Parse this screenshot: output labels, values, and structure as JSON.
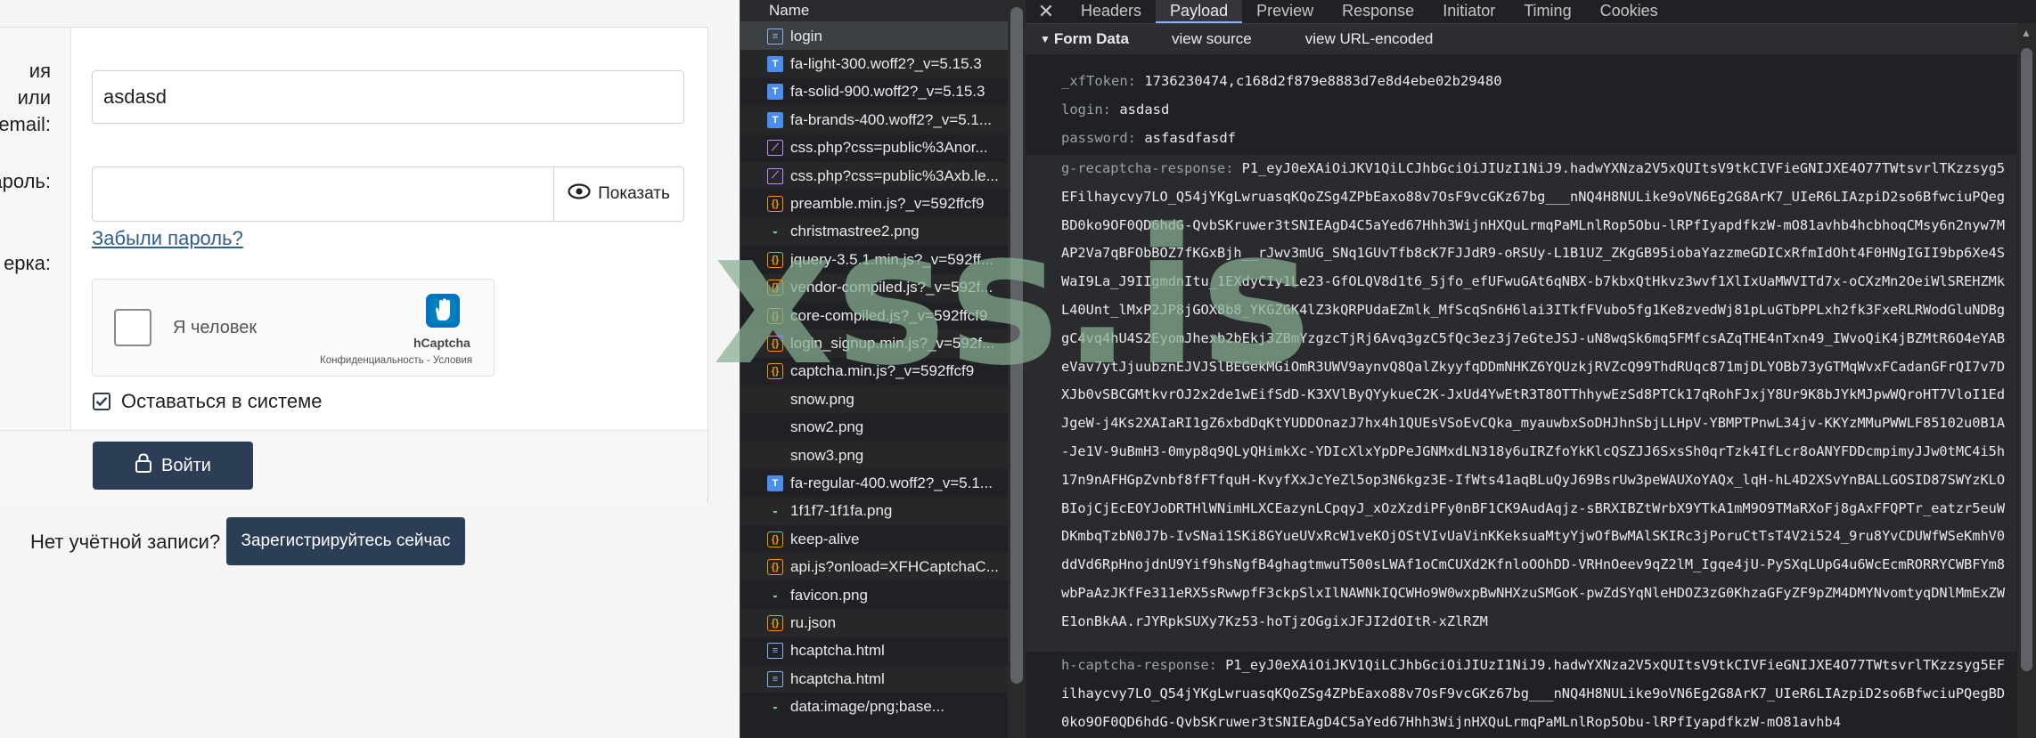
{
  "login": {
    "username_label": "ия или\nemail:",
    "username_value": "asdasd",
    "password_label": "ароль:",
    "show_label": "Показать",
    "forgot_link": "Забыли пароль?",
    "captcha_label": "ерка:",
    "captcha_checkbox_text": "Я человек",
    "captcha_brand": "hCaptcha",
    "captcha_terms": "Конфиденциальность - Условия",
    "remember_label": "Оставаться в системе",
    "login_button": "Войти",
    "no_account_text": "Нет учётной записи?",
    "register_button": "Зарегистрируйтесь сейчас"
  },
  "network": {
    "column_name": "Name",
    "rows": [
      {
        "name": "login",
        "type": "doc"
      },
      {
        "name": "fa-light-300.woff2?_v=5.15.3",
        "type": "font"
      },
      {
        "name": "fa-solid-900.woff2?_v=5.15.3",
        "type": "font"
      },
      {
        "name": "fa-brands-400.woff2?_v=5.1...",
        "type": "font"
      },
      {
        "name": "css.php?css=public%3Anor...",
        "type": "css"
      },
      {
        "name": "css.php?css=public%3Axb.le...",
        "type": "css"
      },
      {
        "name": "preamble.min.js?_v=592ffcf9",
        "type": "js"
      },
      {
        "name": "christmastree2.png",
        "type": "img"
      },
      {
        "name": "jquery-3.5.1.min.js?_v=592ff...",
        "type": "js"
      },
      {
        "name": "vendor-compiled.js?_v=592f...",
        "type": "js"
      },
      {
        "name": "core-compiled.js?_v=592ffcf9",
        "type": "js"
      },
      {
        "name": "login_signup.min.js?_v=592f...",
        "type": "js"
      },
      {
        "name": "captcha.min.js?_v=592ffcf9",
        "type": "js"
      },
      {
        "name": "snow.png",
        "type": "blank"
      },
      {
        "name": "snow2.png",
        "type": "blank"
      },
      {
        "name": "snow3.png",
        "type": "blank"
      },
      {
        "name": "fa-regular-400.woff2?_v=5.1...",
        "type": "font"
      },
      {
        "name": "1f1f7-1f1fa.png",
        "type": "img"
      },
      {
        "name": "keep-alive",
        "type": "js"
      },
      {
        "name": "api.js?onload=XFHCaptchaC...",
        "type": "js"
      },
      {
        "name": "favicon.png",
        "type": "img"
      },
      {
        "name": "ru.json",
        "type": "js"
      },
      {
        "name": "hcaptcha.html",
        "type": "doc"
      },
      {
        "name": "hcaptcha.html",
        "type": "doc"
      },
      {
        "name": "data:image/png;base...",
        "type": "img"
      }
    ]
  },
  "panel": {
    "tabs": [
      "Headers",
      "Payload",
      "Preview",
      "Response",
      "Initiator",
      "Timing",
      "Cookies"
    ],
    "active_tab": "Payload",
    "form_data_title": "Form Data",
    "view_source": "view source",
    "view_url_encoded": "view URL-encoded",
    "fields": {
      "xftoken_key": "_xfToken:",
      "xftoken_value": "1736230474,c168d2f879e8883d7e8d4ebe02b29480",
      "login_key": "login:",
      "login_value": "asdasd",
      "password_key": "password:",
      "password_value": "asfasdfasdf",
      "grecaptcha_key": "g-recaptcha-response:",
      "grecaptcha_value": "P1_eyJ0eXAiOiJKV1QiLCJhbGciOiJIUzI1NiJ9.hadwYXNza2V5xQUItsV9tkCIVFieGNIJXE4O77TWtsvrlTKzzsyg5EFilhaycvy7LO_Q54jYKgLwruasqKQoZSg4ZPbEaxo88v7OsF9vcGKz67bg___nNQ4H8NULike9oVN6Eg2G8ArK7_UIeR6LIAzpiD2so6BfwciuPQegBD0ko9OF0QD6hdG-QvbSKruwer3tSNIEAgD4C5aYed67Hhh3WijnHXQuLrmqPaMLnlRop5Obu-lRPfIyapdfkzW-mO81avhb4hcbhoqCMsy6n2nyw7MAP2Va7qBFObBOZ7fKGxBjh__rJwv3mUG_SNq1GUvTfb8cK7FJJdR9-oRSUy-L1B1UZ_ZKgGB95iobaYazzmeGDICxRfmIdOht4F0HNgIGII9bp6Xe4SWaI9La_J9IIgmdnItu_1EXdyCIy1Le23-GfOLQV8d1t6_5jfo_efUFwuGAt6qNBX-b7kbxQtHkvz3wvf1XlIxUaMWVITd7x-oCXzMn2OeiWlSREHZMkL40Unt_lMxP2JP8jGOX8b8_YKGZGK4lZ3kQRPUdaEZmlk_MfScqSn6H6lai3ITkfFVubo5fg1Ke8zvedWj81pLuGTbPPLxh2fk3FxeRLRWodGluNDBggC4vq4hU4S2EyomJhexb2bEkj3ZBmYzgzcTjRj6Avq3gzC5fQc3ez3j7eGteJSJ-uN8wqSk6mq5FMfcsAZqTHE4nTxn49_IWvoQiK4jBZMtR6O4eYABeVav7ytJjuubznEJVJSlBEGekMGiOmR3UWV9aynvQ8QalZkyyfqDDmNHKZ6YQUzkjRVZcQ99ThdRUqc871mjDLYOBb73yGTMqWvxFCadanGFrQI7v7DXJb0vSBCGMtkvrOJ2x2de1wEifSdD-K3XVlByQYykueC2K-JxUd4YwEtR3T8OTThhywEzSd8PTCk17qRohFJxjY8Ur9K8bJYkMJpwWQroHT7VloI1EdJgeW-j4Ks2XAIaRI1gZ6xbdDqKtYUDDOnazJ7hx4h1QUEsVSoEvCQka_myauwbxSoDHJhnSbjLLHpV-YBMPTPnwL34jv-KKYzMMuPWWLF85102u0B1A-Je1V-9uBmH3-0myp8q9QLyQHimkXc-YDIcXlxYpDPeJGNMxdLN318y6uIRZfoYkKlcQSZJJ6SxsSh0qrTzk4IfLcr8oANYFDDcmpimyJJw0tMC4i5h17n9nAFHGpZvnbf8fFTfquH-KvyfXxJcYeZl5op3N6kgz3E-IfWts41aqBLuQyJ69BsrUw3peWAUXoYAQx_lqH-hL4D2XSvYnBALLGOSID87SWYzKLOBIojCjEcEOYJoDRTHlWNimHLXCEazynLCpqyJ_xOzXzdiPFy0nBF1CK9AudAqjz-sBRXIBZtWrbX9YTkA1mM9O9TMaRXoFj8gAxFFQPTr_eatzr5euWDKmbqTzbN0J7b-IvSNai1SKi8GYueUVxRcW1veKOjOStVIvUaVinKKeksuaMtyYjwOfBwMAlSKIRc3jPoruCtTsT4V2i524_9ru8YvCDUWfWSeKmhV0ddVd6RpHnojdnU9Yif9hsNgfB4ghagtmwuT500sLWAf1oCmCUXd2KfnloOOhDD-VRHnOeev9qZ2lM_Igqe4jU-PySXqLUpG4u6WcEcmRORRYCWBFYm8wbPaAzJKfFe311eRX5sRwwpfF3ckpSlxIlNAWNkIQCWHo9W0wxpBwNHXzuSMGoK-pwZdSYqNleHDOZ3zG0KhzaGFyZF9pZM4DMYNvomtyqDNlMmExZWE1onBkAA.rJYRpkSUXy7Kz53-hoTjzOGgixJFJI2dOItR-xZlRZM",
      "hcaptcha_key": "h-captcha-response:",
      "hcaptcha_value": "P1_eyJ0eXAiOiJKV1QiLCJhbGciOiJIUzI1NiJ9.hadwYXNza2V5xQUItsV9tkCIVFieGNIJXE4O77TWtsvrlTKzzsyg5EFilhaycvy7LO_Q54jYKgLwruasqKQoZSg4ZPbEaxo88v7OsF9vcGKz67bg___nNQ4H8NULike9oVN6Eg2G8ArK7_UIeR6LIAzpiD2so6BfwciuPQegBD0ko9OF0QD6hdG-QvbSKruwer3tSNIEAgD4C5aYed67Hhh3WijnHXQuLrmqPaMLnlRop5Obu-lRPfIyapdfkzW-mO81avhb4"
    }
  },
  "watermark": "xss.is"
}
